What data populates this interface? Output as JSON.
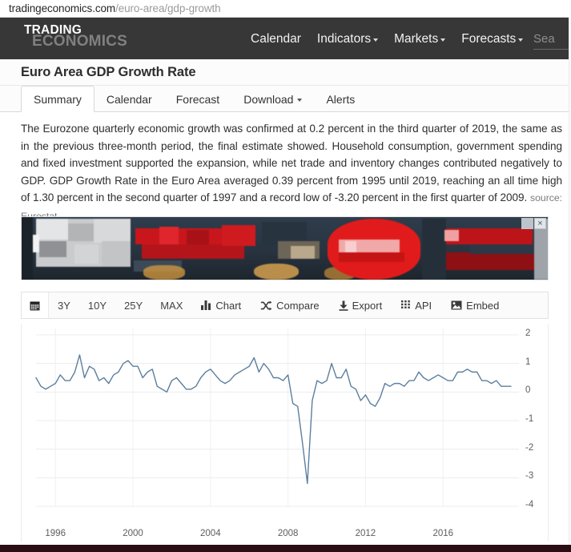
{
  "browser": {
    "url_host": "tradingeconomics.com",
    "url_path": "/euro-area/gdp-growth"
  },
  "site_nav": {
    "logo_top": "TRADING",
    "logo_bottom": "ECONOMICS",
    "items": [
      {
        "label": "Calendar",
        "has_caret": false
      },
      {
        "label": "Indicators",
        "has_caret": true
      },
      {
        "label": "Markets",
        "has_caret": true
      },
      {
        "label": "Forecasts",
        "has_caret": true
      }
    ],
    "search_placeholder": "Sea",
    "bar_color": "#373737"
  },
  "header": {
    "title": "Euro Area GDP Growth Rate"
  },
  "tabs": [
    {
      "label": "Summary",
      "active": true,
      "has_caret": false
    },
    {
      "label": "Calendar",
      "active": false,
      "has_caret": false
    },
    {
      "label": "Forecast",
      "active": false,
      "has_caret": false
    },
    {
      "label": "Download",
      "active": false,
      "has_caret": true
    },
    {
      "label": "Alerts",
      "active": false,
      "has_caret": false
    }
  ],
  "article": {
    "body": "The Eurozone quarterly economic growth was confirmed at 0.2 percent in the third quarter of 2019, the same as in the previous three-month period, the final estimate showed. Household consumption, government spending and fixed investment supported the expansion, while net trade and inventory changes contributed negatively to GDP. GDP Growth Rate in the Euro Area averaged 0.39 percent from 1995 until 2019, reaching an all time high of 1.30 percent in the second quarter of 1997 and a record low of -3.20 percent in the first quarter of 2009.",
    "source": "source: Eurostat"
  },
  "ad": {
    "close_label": "×"
  },
  "chart_toolbar": {
    "calendar_icon": "calendar-icon",
    "buttons": [
      {
        "label": "3Y",
        "icon": null
      },
      {
        "label": "10Y",
        "icon": null
      },
      {
        "label": "25Y",
        "icon": null
      },
      {
        "label": "MAX",
        "icon": null
      },
      {
        "label": "Chart",
        "icon": "bar-chart-icon"
      },
      {
        "label": "Compare",
        "icon": "compare-icon"
      },
      {
        "label": "Export",
        "icon": "download-icon"
      },
      {
        "label": "API",
        "icon": "grid-icon"
      },
      {
        "label": "Embed",
        "icon": "image-icon"
      }
    ]
  },
  "chart_data": {
    "type": "line",
    "title": "Euro Area GDP Growth Rate",
    "xlabel": "",
    "ylabel": "",
    "line_color": "#5b7f9e",
    "grid": true,
    "legend": "none",
    "y_ticks": [
      2,
      1,
      0,
      -1,
      -2,
      -3,
      -4
    ],
    "ylim": [
      -4,
      2
    ],
    "x_ticks": [
      1996,
      2000,
      2004,
      2008,
      2012,
      2016
    ],
    "xlim": [
      1995.0,
      2019.75
    ],
    "units": "percent",
    "average": 0.39,
    "all_time_high": 1.3,
    "all_time_high_period": "Q2 1997",
    "record_low": -3.2,
    "record_low_period": "Q1 2009",
    "series": [
      {
        "name": "GDP Growth Rate",
        "x": [
          1995.0,
          1995.25,
          1995.5,
          1995.75,
          1996.0,
          1996.25,
          1996.5,
          1996.75,
          1997.0,
          1997.25,
          1997.5,
          1997.75,
          1998.0,
          1998.25,
          1998.5,
          1998.75,
          1999.0,
          1999.25,
          1999.5,
          1999.75,
          2000.0,
          2000.25,
          2000.5,
          2000.75,
          2001.0,
          2001.25,
          2001.5,
          2001.75,
          2002.0,
          2002.25,
          2002.5,
          2002.75,
          2003.0,
          2003.25,
          2003.5,
          2003.75,
          2004.0,
          2004.25,
          2004.5,
          2004.75,
          2005.0,
          2005.25,
          2005.5,
          2005.75,
          2006.0,
          2006.25,
          2006.5,
          2006.75,
          2007.0,
          2007.25,
          2007.5,
          2007.75,
          2008.0,
          2008.25,
          2008.5,
          2008.75,
          2009.0,
          2009.25,
          2009.5,
          2009.75,
          2010.0,
          2010.25,
          2010.5,
          2010.75,
          2011.0,
          2011.25,
          2011.5,
          2011.75,
          2012.0,
          2012.25,
          2012.5,
          2012.75,
          2013.0,
          2013.25,
          2013.5,
          2013.75,
          2014.0,
          2014.25,
          2014.5,
          2014.75,
          2015.0,
          2015.25,
          2015.5,
          2015.75,
          2016.0,
          2016.25,
          2016.5,
          2016.75,
          2017.0,
          2017.25,
          2017.5,
          2017.75,
          2018.0,
          2018.25,
          2018.5,
          2018.75,
          2019.0,
          2019.25,
          2019.5
        ],
        "y": [
          0.5,
          0.2,
          0.1,
          0.2,
          0.3,
          0.6,
          0.4,
          0.4,
          0.7,
          1.3,
          0.5,
          0.9,
          0.8,
          0.4,
          0.5,
          0.3,
          0.6,
          0.7,
          1.0,
          1.1,
          0.9,
          0.9,
          0.5,
          0.7,
          0.8,
          0.2,
          0.1,
          0.0,
          0.4,
          0.5,
          0.3,
          0.1,
          0.1,
          0.2,
          0.5,
          0.7,
          0.8,
          0.6,
          0.4,
          0.3,
          0.4,
          0.6,
          0.7,
          0.8,
          0.9,
          1.2,
          0.7,
          1.0,
          0.8,
          0.5,
          0.5,
          0.4,
          0.6,
          -0.4,
          -0.5,
          -1.8,
          -3.2,
          -0.3,
          0.4,
          0.3,
          0.4,
          1.0,
          0.5,
          0.5,
          0.8,
          0.2,
          0.1,
          -0.3,
          -0.1,
          -0.4,
          -0.5,
          -0.2,
          0.3,
          0.2,
          0.3,
          0.3,
          0.2,
          0.4,
          0.4,
          0.7,
          0.5,
          0.4,
          0.5,
          0.6,
          0.5,
          0.4,
          0.4,
          0.7,
          0.7,
          0.8,
          0.7,
          0.7,
          0.4,
          0.4,
          0.3,
          0.4,
          0.2,
          0.2,
          0.2
        ]
      }
    ]
  }
}
